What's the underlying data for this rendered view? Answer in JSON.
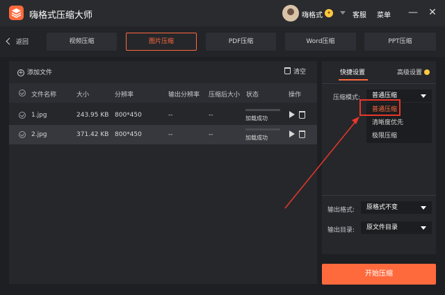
{
  "app": {
    "title": "嗨格式压缩大师"
  },
  "user": {
    "name": "嗨格式"
  },
  "header": {
    "service": "客服",
    "menu": "菜单",
    "minimize": "—",
    "close": "✕"
  },
  "nav": {
    "back": "返回",
    "tabs": [
      "视频压缩",
      "图片压缩",
      "PDF压缩",
      "Word压缩",
      "PPT压缩"
    ],
    "active_index": 1
  },
  "toolbar": {
    "add_file": "添加文件",
    "clear": "清空"
  },
  "table": {
    "columns": [
      "文件名称",
      "大小",
      "分辨率",
      "输出分辨率",
      "压缩后大小",
      "状态",
      "操作"
    ],
    "rows": [
      {
        "name": "1.jpg",
        "size": "243.95 KB",
        "resolution": "800*450",
        "output_resolution": "--",
        "compressed_size": "--",
        "status": "加载成功"
      },
      {
        "name": "2.jpg",
        "size": "371.42 KB",
        "resolution": "800*450",
        "output_resolution": "--",
        "compressed_size": "--",
        "status": "加载成功"
      }
    ]
  },
  "settings": {
    "tabs": [
      "快捷设置",
      "高级设置"
    ],
    "mode_label": "压缩模式:",
    "mode_value": "普通压缩",
    "mode_options": [
      "普通压缩",
      "清晰度优先",
      "极限压缩"
    ],
    "format_label": "输出格式:",
    "format_value": "原格式不变",
    "dir_label": "输出目录:",
    "dir_value": "原文件目录"
  },
  "start_button": "开始压缩",
  "colors": {
    "accent": "#ff6a3d",
    "annotation_red": "#e8372b",
    "background": "#1e1f22"
  }
}
